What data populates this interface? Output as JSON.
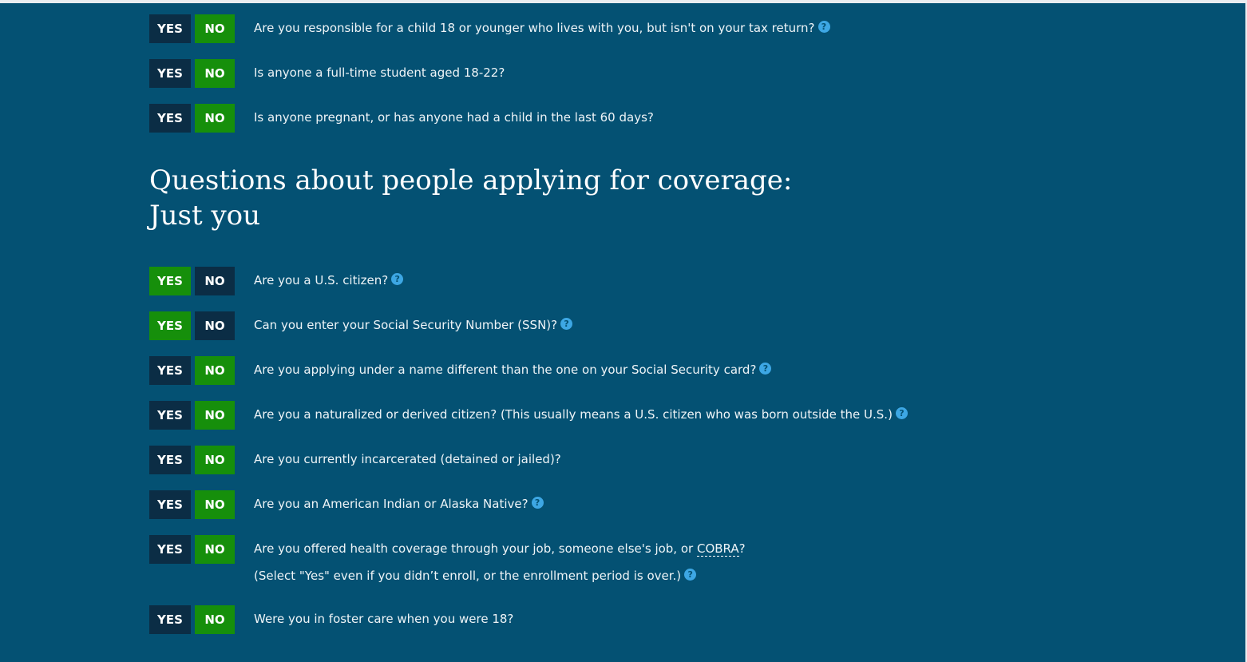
{
  "toggle_labels": {
    "yes": "YES",
    "no": "NO"
  },
  "household_questions": [
    {
      "text": "Are you responsible for a child 18 or younger who lives with you, but isn't on your tax return?",
      "selected": "NO",
      "has_help": true
    },
    {
      "text": "Is anyone a full-time student aged 18-22?",
      "selected": "NO",
      "has_help": false
    },
    {
      "text": "Is anyone pregnant, or has anyone had a child in the last 60 days?",
      "selected": "NO",
      "has_help": false
    }
  ],
  "section": {
    "title_line1": "Questions about people applying for coverage:",
    "title_line2": "Just you"
  },
  "applicant_questions": [
    {
      "text": "Are you a U.S. citizen?",
      "selected": "YES",
      "has_help": true
    },
    {
      "text": "Can you enter your Social Security Number (SSN)?",
      "selected": "YES",
      "has_help": true
    },
    {
      "text": "Are you applying under a name different than the one on your Social Security card?",
      "selected": "NO",
      "has_help": true
    },
    {
      "text": "Are you a naturalized or derived citizen? (This usually means a U.S. citizen who was born outside the U.S.)",
      "selected": "NO",
      "has_help": true
    },
    {
      "text": "Are you currently incarcerated (detained or jailed)?",
      "selected": "NO",
      "has_help": false
    },
    {
      "text": "Are you an American Indian or Alaska Native?",
      "selected": "NO",
      "has_help": true
    },
    {
      "text_before": "Are you offered health coverage through your job, someone else's job, or ",
      "text_abbr": "COBRA",
      "text_after": "?",
      "subtext": "(Select \"Yes\" even if you didn’t enroll, or the enrollment period is over.)",
      "selected": "NO",
      "has_help": true
    },
    {
      "text": "Were you in foster care when you were 18?",
      "selected": "NO",
      "has_help": false
    }
  ],
  "help_icon_glyph": "?",
  "colors": {
    "background": "#045173",
    "selected": "#168f0b",
    "unselected": "#0b2d45",
    "help": "#3da7e4"
  }
}
